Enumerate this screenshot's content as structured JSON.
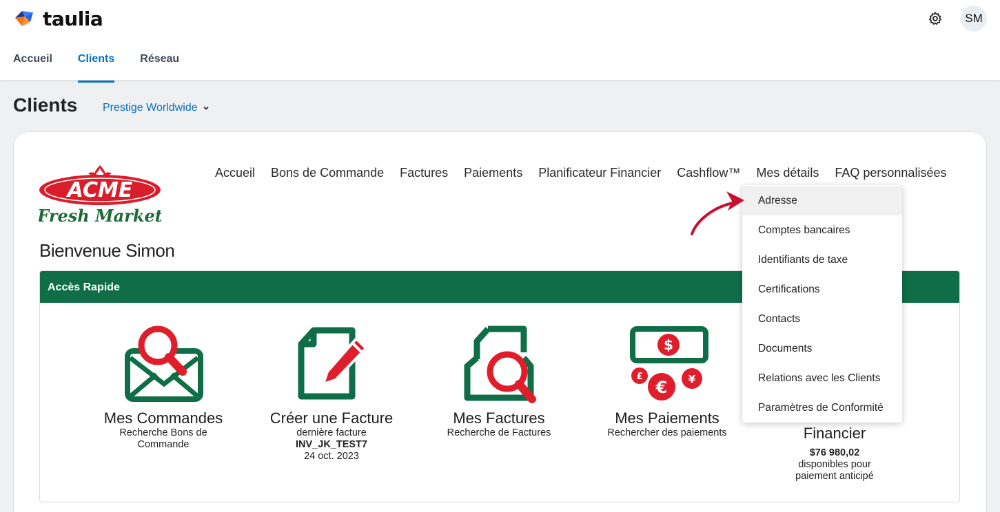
{
  "app": {
    "brand": "taulia",
    "user_initials": "SM"
  },
  "main_nav": [
    {
      "label": "Accueil",
      "active": false
    },
    {
      "label": "Clients",
      "active": true
    },
    {
      "label": "Réseau",
      "active": false
    }
  ],
  "page": {
    "title": "Clients",
    "client_selected": "Prestige Worldwide"
  },
  "customer_portal": {
    "logo": {
      "name": "ACME",
      "tagline": "Fresh Market"
    },
    "nav": [
      "Accueil",
      "Bons de Commande",
      "Factures",
      "Paiements",
      "Planificateur Financier",
      "Cashflow™",
      "Mes détails",
      "FAQ personnalisées"
    ],
    "welcome": "Bienvenue Simon",
    "quick_access_title": "Accès Rapide",
    "tiles": [
      {
        "icon": "orders-search-icon",
        "title": "Mes Commandes",
        "sub": "Recherche Bons de Commande"
      },
      {
        "icon": "create-invoice-icon",
        "title": "Créer une Facture",
        "sub": "dernière facture",
        "bold": "INV_JK_TEST7",
        "date": "24 oct. 2023"
      },
      {
        "icon": "invoice-search-icon",
        "title": "Mes Factures",
        "sub": "Recherche de Factures"
      },
      {
        "icon": "payments-icon",
        "title": "Mes Paiements",
        "sub": "Rechercher des paiements"
      },
      {
        "title": "Financier",
        "amount": "$76 980,02",
        "sub": "disponibles pour paiement anticipé"
      }
    ]
  },
  "dropdown": {
    "items": [
      "Adresse",
      "Comptes bancaires",
      "Identifiants de taxe",
      "Certifications",
      "Contacts",
      "Documents",
      "Relations avec les Clients",
      "Paramètres de Conformité"
    ],
    "hovered_index": 0
  },
  "colors": {
    "accent_blue": "#0a6ebd",
    "brand_green": "#0f6e48",
    "icon_red": "#e01e2b",
    "arrow_red": "#c8102e"
  }
}
